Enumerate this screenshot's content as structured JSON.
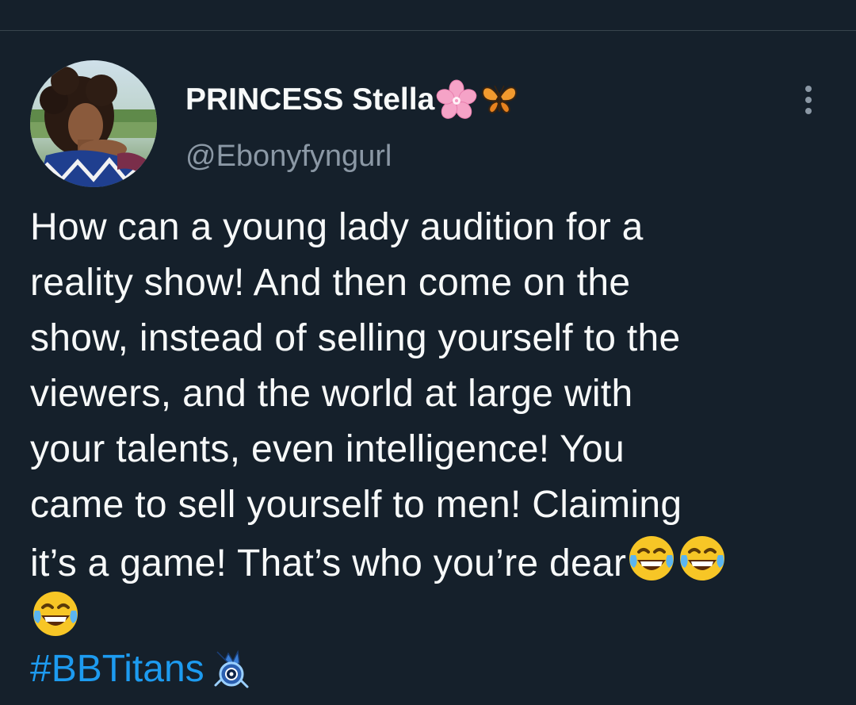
{
  "author": {
    "display_name": "PRINCESS Stella",
    "name_emojis": [
      "cherry-blossom-emoji",
      "butterfly-emoji"
    ],
    "handle": "@Ebonyfyngurl"
  },
  "tweet": {
    "lines": [
      "How can a young lady audition for a",
      "reality show! And then come on the",
      "show, instead of selling yourself to the",
      "viewers, and the world at large with",
      "your talents, even intelligence! You",
      "came to sell yourself to men! Claiming",
      "it’s a game! That’s who you’re dear"
    ],
    "trailing_emojis": [
      "face-with-tears-of-joy-emoji",
      "face-with-tears-of-joy-emoji",
      "face-with-tears-of-joy-emoji"
    ],
    "hashtag": "#BBTitans",
    "hashflag_icon": "bbtitans-hashflag-icon"
  },
  "colors": {
    "background": "#15202b",
    "text": "#f7f9f9",
    "secondary_text": "#8b98a5",
    "link": "#1d9bf0",
    "divider": "#38444d"
  },
  "icons": {
    "more": "more-vertical-icon"
  }
}
